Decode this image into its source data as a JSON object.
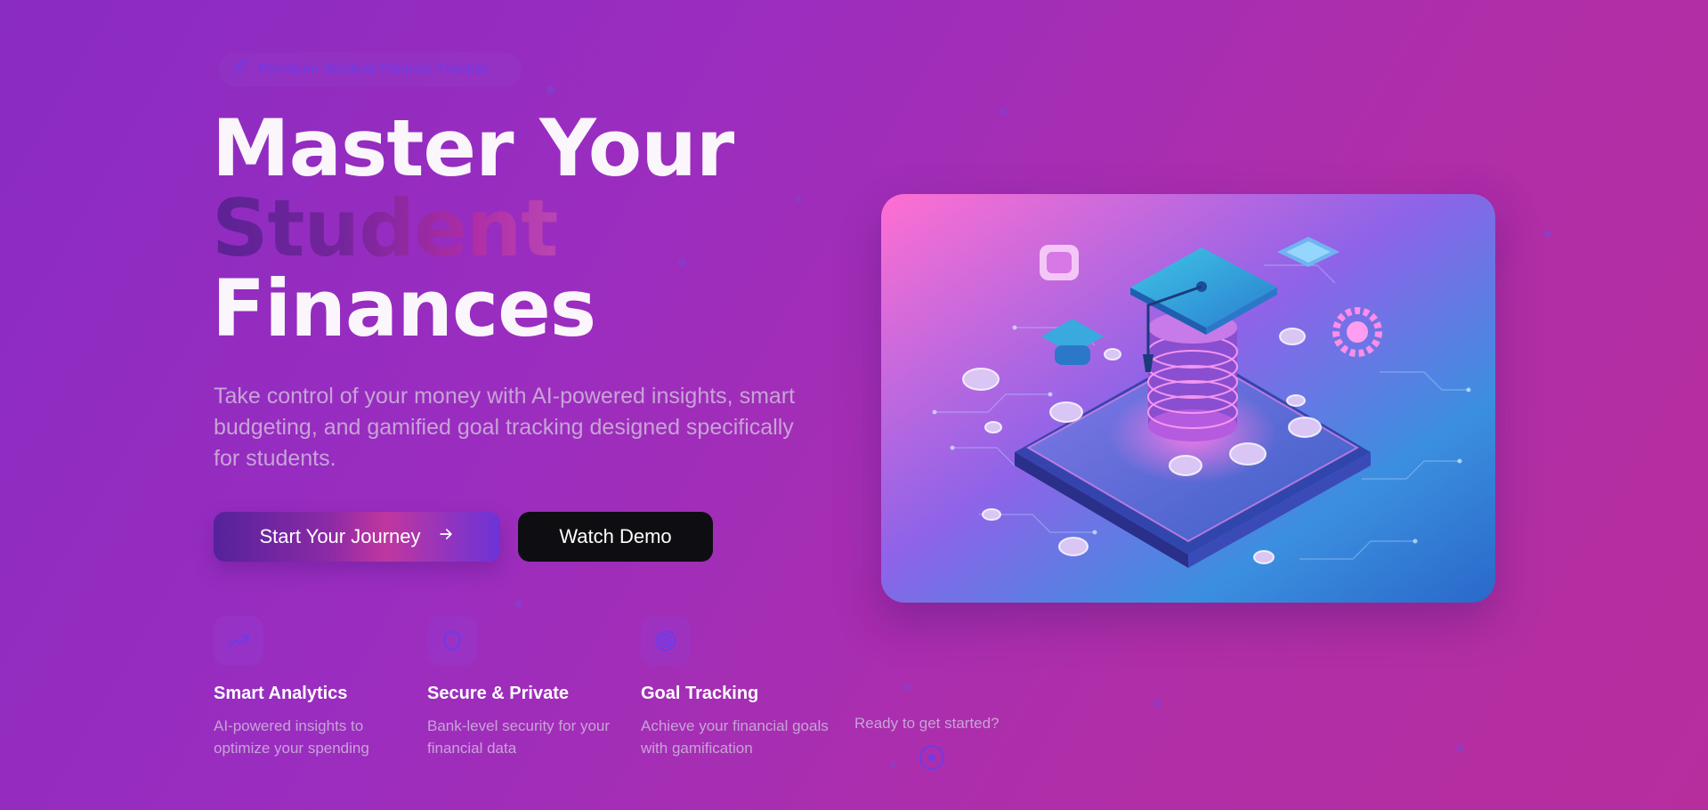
{
  "badge": {
    "icon": "sparkles-icon",
    "label": "Premium Student Finance Tracker"
  },
  "hero": {
    "line1": "Master Your",
    "line2": "Student",
    "line3": "Finances",
    "subtitle": "Take control of your money with AI-powered insights, smart budgeting, and gamified goal tracking designed specifically for students."
  },
  "buttons": {
    "primary_label": "Start Your Journey",
    "primary_icon": "arrow-right-icon",
    "secondary_label": "Watch Demo"
  },
  "features": [
    {
      "icon": "trending-up-icon",
      "title": "Smart Analytics",
      "description": "AI-powered insights to optimize your spending"
    },
    {
      "icon": "shield-icon",
      "title": "Secure & Private",
      "description": "Bank-level security for your financial data"
    },
    {
      "icon": "target-icon",
      "title": "Goal Tracking",
      "description": "Achieve your financial goals with gamification"
    }
  ],
  "cta": {
    "ready_text": "Ready to get started?"
  },
  "colors": {
    "background_start": "#8a2bc2",
    "background_end": "#b62e9e",
    "accent": "#6f3be6",
    "secondary_button": "#0e0e12",
    "muted_text": "#c7a3d6"
  }
}
